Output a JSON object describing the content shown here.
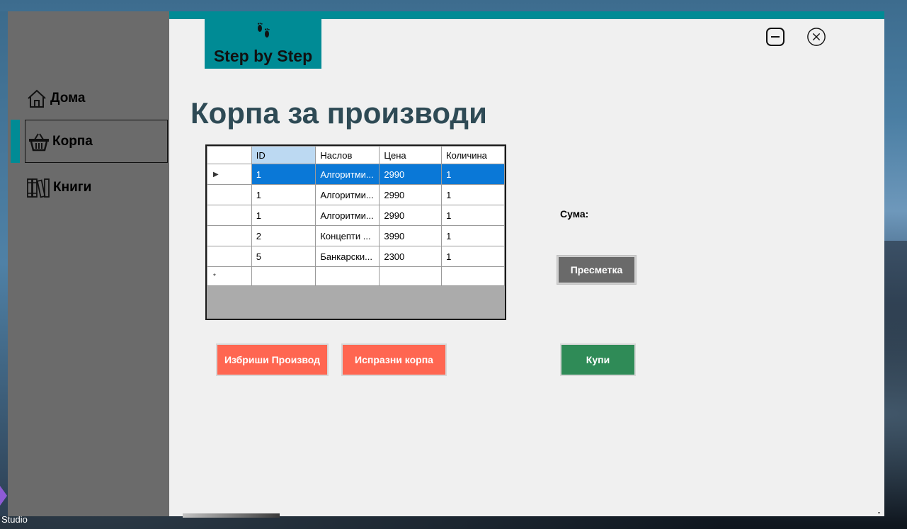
{
  "desktop": {
    "taskbar_label": "Studio"
  },
  "brand": {
    "name": "Step by Step",
    "feet_icon": "footprints-icon",
    "color": "#008b95"
  },
  "window_controls": {
    "minimize_icon": "minimize-icon",
    "close_icon": "close-icon"
  },
  "sidebar": {
    "items": [
      {
        "label": "Дома",
        "icon": "home-icon",
        "active": false
      },
      {
        "label": "Корпа",
        "icon": "basket-icon",
        "active": true
      },
      {
        "label": "Книги",
        "icon": "books-icon",
        "active": false
      }
    ],
    "active_color": "#008b95"
  },
  "page": {
    "title": "Корпа за производи"
  },
  "cart_grid": {
    "columns": [
      "ID",
      "Наслов",
      "Цена",
      "Количина"
    ],
    "rows": [
      {
        "id": "1",
        "title": "Алгоритми...",
        "price": "2990",
        "qty": "1",
        "selected": true
      },
      {
        "id": "1",
        "title": "Алгоритми...",
        "price": "2990",
        "qty": "1",
        "selected": false
      },
      {
        "id": "1",
        "title": "Алгоритми...",
        "price": "2990",
        "qty": "1",
        "selected": false
      },
      {
        "id": "2",
        "title": "Концепти ...",
        "price": "3990",
        "qty": "1",
        "selected": false
      },
      {
        "id": "5",
        "title": "Банкарски...",
        "price": "2300",
        "qty": "1",
        "selected": false
      }
    ],
    "current_row_marker": "▶",
    "new_row_marker": "*"
  },
  "summary": {
    "sum_label": "Сума:"
  },
  "buttons": {
    "calculate": "Пресметка",
    "delete_product": "Избриши Производ",
    "empty_cart": "Испразни корпа",
    "buy": "Купи"
  },
  "colors": {
    "danger": "#ff6651",
    "success": "#2f8b57",
    "neutral": "#6a6a6a",
    "selection": "#0a78d7"
  }
}
